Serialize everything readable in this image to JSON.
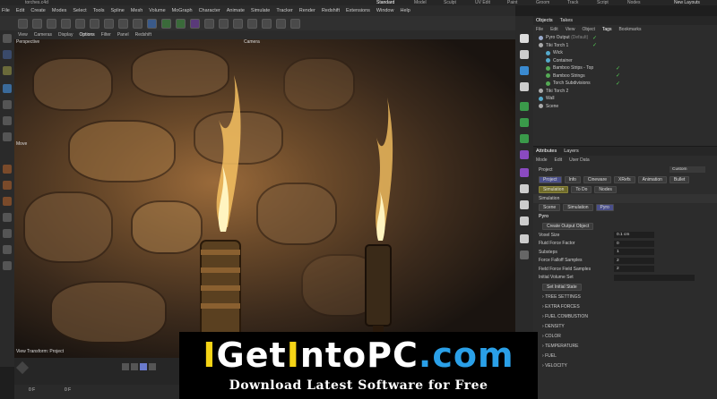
{
  "window": {
    "file_title": "torches.c4d",
    "tabs": [
      "Standard",
      "Model",
      "Sculpt",
      "UV Edit",
      "Paint",
      "Groom",
      "Track",
      "Script",
      "Nodes"
    ],
    "new_layouts": "New Layouts"
  },
  "menu": [
    "File",
    "Edit",
    "Create",
    "Modes",
    "Select",
    "Tools",
    "Spline",
    "Mesh",
    "Volume",
    "MoGraph",
    "Character",
    "Animate",
    "Simulate",
    "Tracker",
    "Render",
    "Redshift",
    "Extensions",
    "Window",
    "Help"
  ],
  "view_menu": [
    "View",
    "Cameras",
    "Display",
    "Options",
    "Filter",
    "Panel",
    "Redshift"
  ],
  "viewport": {
    "label": "Perspective",
    "camera": "Camera",
    "view_transform": "View Transform: Project",
    "tool": "Move"
  },
  "timeline": {
    "frame_start": "0 F",
    "frame_cur": "0 F"
  },
  "objects_panel": {
    "tabs": [
      "Objects",
      "Takes"
    ],
    "menu": [
      "File",
      "Edit",
      "View",
      "Object",
      "Tags",
      "Bookmarks"
    ],
    "items": [
      {
        "name": "Pyro Output",
        "suffix": "(Default)",
        "indent": 0,
        "check": true
      },
      {
        "name": "Tiki Torch 1",
        "suffix": "",
        "indent": 0,
        "check": true
      },
      {
        "name": "Wick",
        "suffix": "",
        "indent": 1,
        "check": false
      },
      {
        "name": "Container",
        "suffix": "",
        "indent": 1,
        "check": false
      },
      {
        "name": "Bamboo Strips - Top",
        "suffix": "",
        "indent": 1,
        "check": true
      },
      {
        "name": "Bamboo Strings",
        "suffix": "",
        "indent": 1,
        "check": true
      },
      {
        "name": "Torch Subdivisions",
        "suffix": "",
        "indent": 1,
        "check": true
      },
      {
        "name": "Tiki Torch 2",
        "suffix": "",
        "indent": 0,
        "check": false
      },
      {
        "name": "Wall",
        "suffix": "",
        "indent": 0,
        "check": false
      },
      {
        "name": "Scene",
        "suffix": "",
        "indent": 0,
        "check": false
      }
    ]
  },
  "attributes_panel": {
    "tabs": [
      "Attributes",
      "Layers"
    ],
    "menu": [
      "Mode",
      "Edit",
      "User Data"
    ],
    "project_label": "Project",
    "custom": "Custom",
    "tabs_row1": [
      "Project",
      "Info",
      "Cineware",
      "XRefs",
      "Animation",
      "Bullet"
    ],
    "tabs_row2": [
      "Simulation",
      "To Do",
      "Nodes"
    ],
    "simulation_header": "Simulation",
    "tabs_row3": [
      "Scene",
      "Simulation",
      "Pyro"
    ],
    "pyro_header": "Pyro",
    "create_output_btn": "Create Output Object",
    "fields": [
      {
        "label": "Voxel Size",
        "value": "0.1 cm"
      },
      {
        "label": "Fluid Force Factor",
        "value": "0"
      },
      {
        "label": "Substeps",
        "value": "1"
      },
      {
        "label": "Force Falloff Samples",
        "value": "2"
      },
      {
        "label": "Field Force Field Samples",
        "value": "2"
      },
      {
        "label": "Initial Volume Set",
        "value": ""
      }
    ],
    "set_initial_btn": "Set Initial State",
    "sections": [
      "TREE SETTINGS",
      "EXTRA FORCES",
      "FUEL COMBUSTION",
      "DENSITY",
      "COLOR",
      "TEMPERATURE",
      "FUEL",
      "VELOCITY"
    ]
  },
  "banner": {
    "title_parts": [
      {
        "text": "I",
        "color": "#f5d416"
      },
      {
        "text": "Get",
        "color": "#ffffff"
      },
      {
        "text": "I",
        "color": "#f5d416"
      },
      {
        "text": "nto",
        "color": "#ffffff"
      },
      {
        "text": "PC",
        "color": "#ffffff"
      },
      {
        "text": ".com",
        "color": "#2aa0e8"
      }
    ],
    "title_display": "IGetIntoPC.com",
    "subtitle": "Download Latest Software for Free"
  }
}
